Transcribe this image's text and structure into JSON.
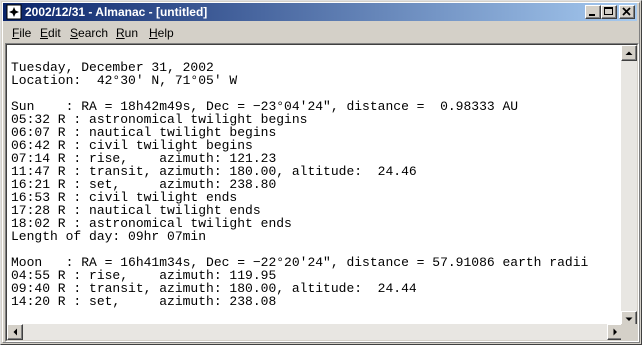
{
  "window": {
    "title": "2002/12/31 - Almanac - [untitled]",
    "title_bar_color": "#0a246a"
  },
  "icons": {
    "app": "almanac-app-icon",
    "minimize": "minimize-icon",
    "maximize": "maximize-icon",
    "close": "close-icon"
  },
  "menu": {
    "file": "File",
    "edit": "Edit",
    "search": "Search",
    "run": "Run",
    "help": "Help"
  },
  "document": {
    "lines": [
      "Tuesday, December 31, 2002",
      "Location:  42°30' N, 71°05' W",
      "",
      "Sun    : RA = 18h42m49s, Dec = −23°04'24\", distance =  0.98333 AU",
      "05:32 R : astronomical twilight begins",
      "06:07 R : nautical twilight begins",
      "06:42 R : civil twilight begins",
      "07:14 R : rise,    azimuth: 121.23",
      "11:47 R : transit, azimuth: 180.00, altitude:  24.46",
      "16:21 R : set,     azimuth: 238.80",
      "16:53 R : civil twilight ends",
      "17:28 R : nautical twilight ends",
      "18:02 R : astronomical twilight ends",
      "Length of day: 09hr 07min",
      "",
      "Moon   : RA = 16h41m34s, Dec = −22°20'24\", distance = 57.91086 earth radii",
      "04:55 R : rise,    azimuth: 119.95",
      "09:40 R : transit, azimuth: 180.00, altitude:  24.44",
      "14:20 R : set,     azimuth: 238.08"
    ]
  }
}
